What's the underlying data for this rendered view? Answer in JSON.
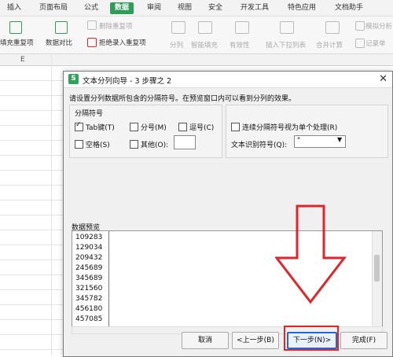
{
  "tabs": [
    "插入",
    "页面布局",
    "公式",
    "数据",
    "审阅",
    "视图",
    "安全",
    "开发工具",
    "特色应用",
    "文档助手"
  ],
  "ribbon": {
    "left_buttons": [
      "填充重复项",
      "数据对比",
      "拒绝录入重复项"
    ],
    "remove_dup": "删除重复项",
    "right_buttons": [
      "分列",
      "智能填充",
      "有效性",
      "插入下拉列表",
      "合并计算",
      "记录单"
    ],
    "simulate": "模拟分析"
  },
  "sheet": {
    "column_label": "E"
  },
  "dialog": {
    "title": "文本分列向导 - 3 步骤之 2",
    "description": "请设置分列数据所包含的分隔符号。在预览窗口内可以看到分列的效果。",
    "delimiters_group": "分隔符号",
    "options": {
      "tab": "Tab键(T)",
      "semicolon": "分号(M)",
      "comma": "逗号(C)",
      "space": "空格(S)",
      "other": "其他(O):"
    },
    "option_checked": {
      "tab": true,
      "semicolon": false,
      "comma": false,
      "space": false,
      "other": false
    },
    "consecutive": "连续分隔符号视为单个处理(R)",
    "qualifier_label": "文本识别符号(Q):",
    "qualifier_value": "\"",
    "preview_label": "数据预览",
    "preview_rows": [
      "109283",
      "129034",
      "209432",
      "245689",
      "345689",
      "321560",
      "345782",
      "456180",
      "457085"
    ],
    "buttons": {
      "cancel": "取消",
      "back": "<上一步(B)",
      "next": "下一步(N)>",
      "finish": "完成(F)"
    }
  },
  "colors": {
    "accent": "#2f9c5a",
    "annotation": "#e0262b",
    "primary_border": "#2a67c7"
  }
}
